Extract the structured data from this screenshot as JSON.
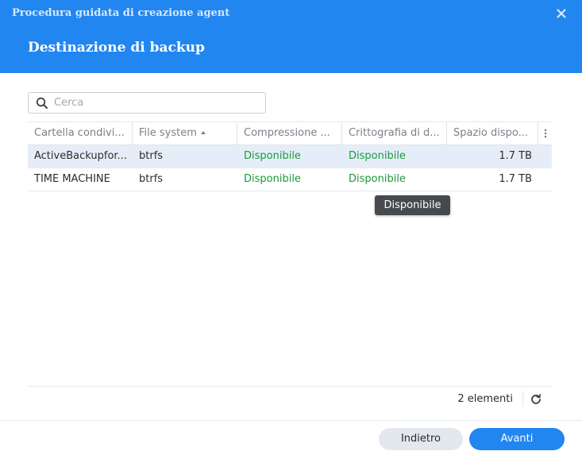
{
  "wizard": {
    "title": "Procedura guidata di creazione agent",
    "step_title": "Destinazione di backup"
  },
  "search": {
    "placeholder": "Cerca",
    "value": ""
  },
  "table": {
    "columns": [
      "Cartella condivi...",
      "File system",
      "Compressione ...",
      "Crittografia di d...",
      "Spazio dispo..."
    ],
    "sorted_column": "File system",
    "sort_direction": "ascending",
    "rows": [
      [
        "ActiveBackupfor...",
        "btrfs",
        "Disponibile",
        "Disponibile",
        "1.7 TB"
      ],
      [
        "TIME MACHINE",
        "btrfs",
        "Disponibile",
        "Disponibile",
        "1.7 TB"
      ]
    ],
    "selected_row": 0
  },
  "tooltip": {
    "text": "Disponibile"
  },
  "footer": {
    "count": "2 elementi"
  },
  "buttons": {
    "back": "Indietro",
    "next": "Avanti"
  },
  "colors": {
    "header": "#2186f0",
    "selected_row": "#e5eef8",
    "available_text": "#1a9a3a",
    "primary_button": "#2186f0"
  },
  "icons": {
    "close": "close-icon",
    "search": "search-icon",
    "column_menu": "vertical-ellipsis-icon",
    "refresh": "refresh-icon",
    "sort": "sort-ascending-icon"
  }
}
